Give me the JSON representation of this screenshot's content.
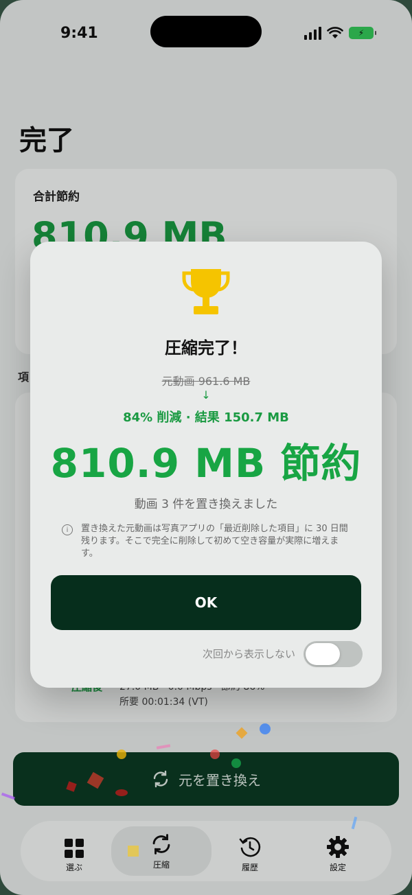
{
  "status": {
    "time": "9:41"
  },
  "page": {
    "title": "完了",
    "summary_label": "合計節約",
    "summary_value": "810.9 MB",
    "section_label": "項",
    "item": {
      "label": "圧縮後",
      "meta": "27.0 MB · 0.0 Mbps · 節約 86%",
      "time": "所要 00:01:34 (VT)"
    }
  },
  "replace_button": {
    "label": "元を置き換え",
    "icon": "refresh-icon"
  },
  "tabs": [
    {
      "label": "選ぶ",
      "icon": "grid-icon"
    },
    {
      "label": "圧縮",
      "icon": "refresh-icon",
      "active": true
    },
    {
      "label": "履歴",
      "icon": "history-icon"
    },
    {
      "label": "設定",
      "icon": "gear-icon"
    }
  ],
  "modal": {
    "title": "圧縮完了！",
    "original": "元動画 961.6 MB",
    "arrow": "↓",
    "result": "84% 削減 · 結果 150.7 MB",
    "saved": "810.9 MB 節約",
    "replaced": "動画 3 件を置き換えました",
    "info": "置き換えた元動画は写真アプリの「最近削除した項目」に 30 日間残ります。そこで完全に削除して初めて空き容量が実際に増えます。",
    "ok_label": "OK",
    "dont_show_label": "次回から表示しない",
    "dont_show_enabled": false
  },
  "colors": {
    "accent_green": "#18a544",
    "dark_green": "#062e1c"
  }
}
